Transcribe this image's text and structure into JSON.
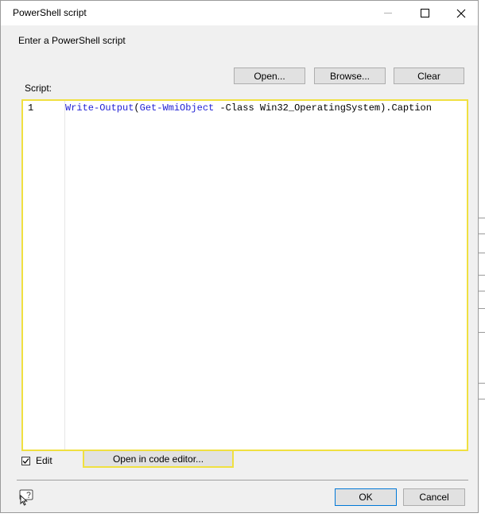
{
  "window": {
    "title": "PowerShell script"
  },
  "dialog": {
    "prompt": "Enter a PowerShell script",
    "buttons": {
      "open": "Open...",
      "browse": "Browse...",
      "clear": "Clear",
      "open_code_editor": "Open in code editor...",
      "ok": "OK",
      "cancel": "Cancel"
    },
    "script_label": "Script:",
    "editor": {
      "line_number": "1",
      "code_tokens": {
        "cmd1": "Write-Output",
        "paren_open": "(",
        "cmd2": "Get-WmiObject",
        "space": " ",
        "param": "-Class",
        "arg": " Win32_OperatingSystem",
        "rest": ").Caption"
      }
    },
    "edit_checkbox": {
      "label": "Edit",
      "checked": true
    }
  },
  "colors": {
    "highlight_border": "#f0e040",
    "cmdlet": "#1f1fd4",
    "ok_border": "#0078d7"
  },
  "icons": {
    "help": "help-cursor-icon",
    "close": "close-icon",
    "maximize": "maximize-icon",
    "minimize": "minimize-icon"
  }
}
